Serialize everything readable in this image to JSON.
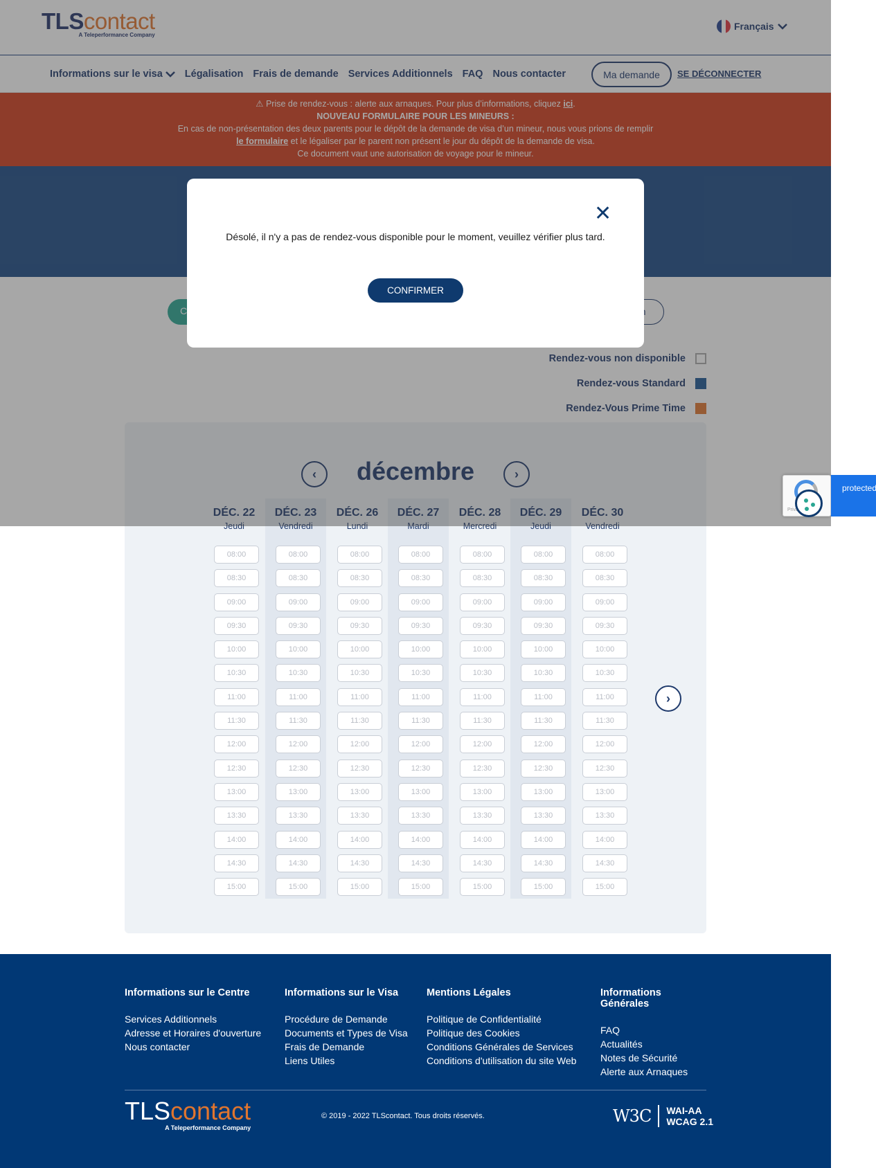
{
  "header": {
    "logo_tls": "TLS",
    "logo_contact": "contact",
    "logo_sub": "A Teleperformance Company",
    "language": "Français"
  },
  "nav": {
    "items": [
      "Informations sur le visa",
      "Légalisation",
      "Frais de demande",
      "Services Additionnels",
      "FAQ",
      "Nous contacter"
    ],
    "my_request": "Ma demande",
    "logout": "SE DÉCONNECTER"
  },
  "alert": {
    "line1_prefix": "⚠ Prise de rendez-vous : alerte aux arnaques. Pour plus d’informations, cliquez ",
    "line1_link": "ici",
    "line1_suffix": ".",
    "line2": "NOUVEAU FORMULAIRE POUR LES MINEURS :",
    "line3_prefix": "En cas de non-présentation des deux parents pour le dépôt de la demande de visa d’un mineur, nous vous prions de remplir ",
    "line3_link": "le formulaire",
    "line3_suffix": " et le légaliser par le parent non présent le jour du dépôt de la demande de visa.",
    "line4": "Ce document vaut une autorisation de voyage pour le mineur."
  },
  "tabs": {
    "left_partial": "C",
    "right_partial": "on"
  },
  "legend": [
    {
      "label": "Rendez-vous non disponible",
      "type": "none"
    },
    {
      "label": "Rendez-vous Standard",
      "type": "std",
      "color": "#1d5694"
    },
    {
      "label": "Rendez-Vous Prime Time",
      "type": "prime",
      "color": "#e0752e"
    }
  ],
  "calendar": {
    "month": "décembre",
    "days": [
      {
        "date": "DÉC. 22",
        "weekday": "Jeudi",
        "shaded": false
      },
      {
        "date": "DÉC. 23",
        "weekday": "Vendredi",
        "shaded": true
      },
      {
        "date": "DÉC. 26",
        "weekday": "Lundi",
        "shaded": false
      },
      {
        "date": "DÉC. 27",
        "weekday": "Mardi",
        "shaded": true
      },
      {
        "date": "DÉC. 28",
        "weekday": "Mercredi",
        "shaded": false
      },
      {
        "date": "DÉC. 29",
        "weekday": "Jeudi",
        "shaded": true
      },
      {
        "date": "DÉC. 30",
        "weekday": "Vendredi",
        "shaded": false
      }
    ],
    "times": [
      "08:00",
      "08:30",
      "09:00",
      "09:30",
      "10:00",
      "10:30",
      "11:00",
      "11:30",
      "12:00",
      "12:30",
      "13:00",
      "13:30",
      "14:00",
      "14:30",
      "15:00"
    ]
  },
  "modal": {
    "message": "Désolé, il n'y a pas de rendez-vous disponible pour le moment, veuillez vérifier plus tard.",
    "confirm": "CONFIRMER",
    "close": "✕"
  },
  "footer": {
    "columns": [
      {
        "title": "Informations sur le Centre",
        "links": [
          "Services Additionnels",
          "Adresse et Horaires d'ouverture",
          "Nous contacter"
        ]
      },
      {
        "title": "Informations sur le Visa",
        "links": [
          "Procédure de Demande",
          "Documents et Types de Visa",
          "Frais de Demande",
          "Liens Utiles"
        ]
      },
      {
        "title": "Mentions Légales",
        "links": [
          "Politique de Confidentialité",
          "Politique des Cookies",
          "Conditions Générales de Services",
          "Conditions d'utilisation du site Web"
        ]
      },
      {
        "title": "Informations Générales",
        "links": [
          "FAQ",
          "Actualités",
          "Notes de Sécurité",
          "Alerte aux Arnaques"
        ]
      }
    ],
    "copyright": "© 2019 - 2022 TLScontact. Tous droits réservés.",
    "w3c": "W3C",
    "wcag_line1": "WAI-AA",
    "wcag_line2": "WCAG 2.1"
  },
  "recaptcha": {
    "protected": "protected",
    "privacy": "Privacy - Terms"
  }
}
